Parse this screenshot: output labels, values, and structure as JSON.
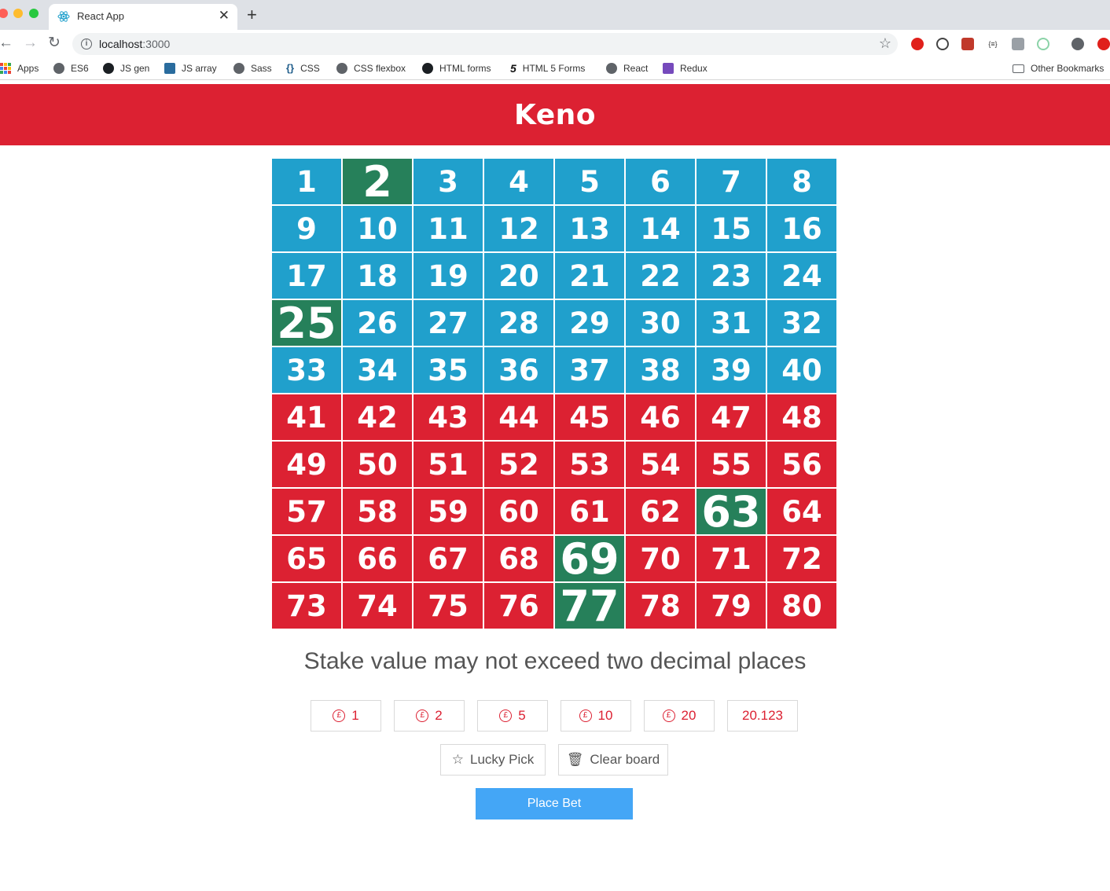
{
  "browser": {
    "tab_title": "React App",
    "url_host": "localhost",
    "url_port": ":3000",
    "bookmarks": [
      {
        "label": "Apps",
        "icon": "apps-grid-icon"
      },
      {
        "label": "ES6",
        "icon": "globe-icon"
      },
      {
        "label": "JS gen",
        "icon": "github-icon"
      },
      {
        "label": "JS array",
        "icon": "site-icon"
      },
      {
        "label": "Sass",
        "icon": "globe-icon"
      },
      {
        "label": "CSS",
        "icon": "braces-icon"
      },
      {
        "label": "CSS flexbox",
        "icon": "globe-icon"
      },
      {
        "label": "HTML forms",
        "icon": "github-icon"
      },
      {
        "label": "HTML 5 Forms",
        "icon": "html5-icon"
      },
      {
        "label": "React",
        "icon": "globe-icon"
      },
      {
        "label": "Redux",
        "icon": "redux-icon"
      }
    ],
    "other_bookmarks": "Other Bookmarks"
  },
  "page": {
    "title": "Keno",
    "numbers": [
      "1",
      "2",
      "3",
      "4",
      "5",
      "6",
      "7",
      "8",
      "9",
      "10",
      "11",
      "12",
      "13",
      "14",
      "15",
      "16",
      "17",
      "18",
      "19",
      "20",
      "21",
      "22",
      "23",
      "24",
      "25",
      "26",
      "27",
      "28",
      "29",
      "30",
      "31",
      "32",
      "33",
      "34",
      "35",
      "36",
      "37",
      "38",
      "39",
      "40",
      "41",
      "42",
      "43",
      "44",
      "45",
      "46",
      "47",
      "48",
      "49",
      "50",
      "51",
      "52",
      "53",
      "54",
      "55",
      "56",
      "57",
      "58",
      "59",
      "60",
      "61",
      "62",
      "63",
      "64",
      "65",
      "66",
      "67",
      "68",
      "69",
      "70",
      "71",
      "72",
      "73",
      "74",
      "75",
      "76",
      "77",
      "78",
      "79",
      "80"
    ],
    "picked_numbers": [
      2,
      25,
      63,
      69,
      77
    ],
    "message": "Stake value may not exceed two decimal places",
    "stakes": [
      "1",
      "2",
      "5",
      "10",
      "20"
    ],
    "custom_stake_value": "20.123",
    "lucky_pick_label": "Lucky Pick",
    "clear_board_label": "Clear board",
    "place_bet_label": "Place Bet"
  },
  "colors": {
    "header": "#dc2132",
    "upper_board": "#20a0cc",
    "lower_board": "#dc2132",
    "picked": "#26805a",
    "place_bet": "#44a6f6"
  }
}
